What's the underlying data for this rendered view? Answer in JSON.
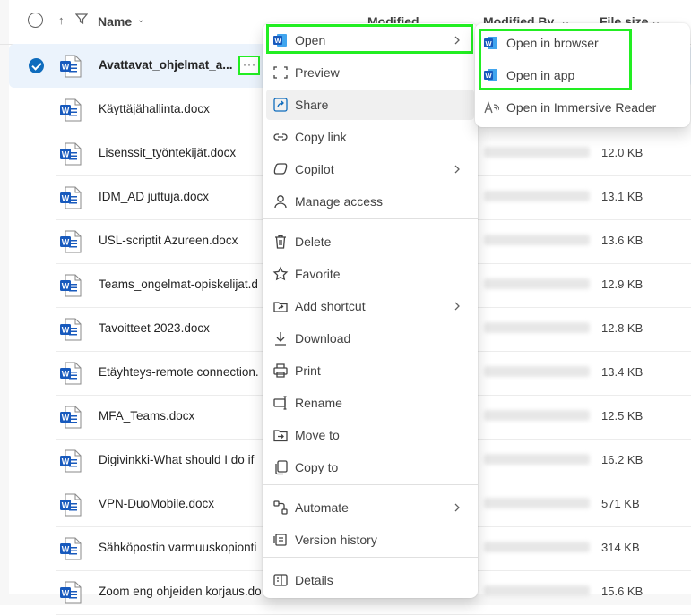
{
  "header": {
    "name_label": "Name",
    "modified_label": "Modified",
    "modified_by_label": "Modified By",
    "file_size_label": "File size"
  },
  "files": [
    {
      "name": "Avattavat_ohjelmat_a...",
      "size": "",
      "selected": true
    },
    {
      "name": "Käyttäjähallinta.docx",
      "size": ""
    },
    {
      "name": "Lisenssit_työntekijät.docx",
      "size": "12.0 KB"
    },
    {
      "name": "IDM_AD juttuja.docx",
      "size": "13.1 KB"
    },
    {
      "name": "USL-scriptit Azureen.docx",
      "size": "13.6 KB"
    },
    {
      "name": "Teams_ongelmat-opiskelijat.d",
      "size": "12.9 KB"
    },
    {
      "name": "Tavoitteet 2023.docx",
      "size": "12.8 KB"
    },
    {
      "name": "Etäyhteys-remote connection.",
      "size": "13.4 KB"
    },
    {
      "name": "MFA_Teams.docx",
      "size": "12.5 KB"
    },
    {
      "name": "Digivinkki-What should I do if",
      "size": "16.2 KB"
    },
    {
      "name": "VPN-DuoMobile.docx",
      "size": "571 KB"
    },
    {
      "name": "Sähköpostin varmuuskopionti",
      "size": "314 KB"
    },
    {
      "name": "Zoom eng ohjeiden korjaus.do",
      "size": "15.6 KB"
    }
  ],
  "context_menu": {
    "items": [
      {
        "label": "Open",
        "icon": "word-icon",
        "submenu": true
      },
      {
        "label": "Preview",
        "icon": "preview-icon"
      },
      {
        "label": "Share",
        "icon": "share-icon"
      },
      {
        "label": "Copy link",
        "icon": "link-icon"
      },
      {
        "label": "Copilot",
        "icon": "copilot-icon",
        "submenu": true
      },
      {
        "label": "Manage access",
        "icon": "person-icon"
      },
      {
        "label": "Delete",
        "icon": "trash-icon"
      },
      {
        "label": "Favorite",
        "icon": "star-icon"
      },
      {
        "label": "Add shortcut",
        "icon": "shortcut-icon",
        "submenu": true
      },
      {
        "label": "Download",
        "icon": "download-icon"
      },
      {
        "label": "Print",
        "icon": "print-icon"
      },
      {
        "label": "Rename",
        "icon": "rename-icon"
      },
      {
        "label": "Move to",
        "icon": "move-icon"
      },
      {
        "label": "Copy to",
        "icon": "copy-icon"
      },
      {
        "label": "Automate",
        "icon": "automate-icon",
        "submenu": true
      },
      {
        "label": "Version history",
        "icon": "history-icon"
      },
      {
        "label": "Details",
        "icon": "details-icon"
      }
    ]
  },
  "open_submenu": {
    "items": [
      {
        "label": "Open in browser",
        "icon": "word-icon"
      },
      {
        "label": "Open in app",
        "icon": "word-icon"
      },
      {
        "label": "Open in Immersive Reader",
        "icon": "immersive-reader-icon"
      }
    ]
  },
  "colors": {
    "accent": "#0f6cbd",
    "highlight": "#22ee22",
    "word": "#185abd"
  }
}
